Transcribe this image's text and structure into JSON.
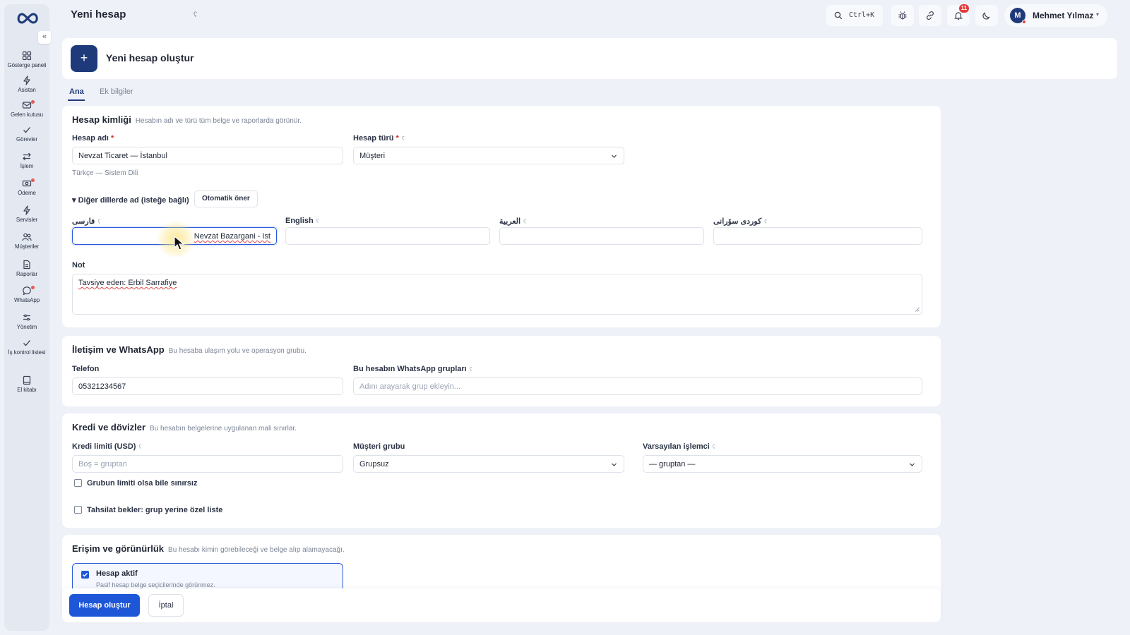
{
  "colors": {
    "accent": "#1f3a7a",
    "primary_button": "#1e56d8",
    "badge": "#e23b3b",
    "focus": "#2b5bd7"
  },
  "sidebar": {
    "collapse_icon": "«",
    "items": [
      {
        "label": "Gösterge paneli",
        "icon": "grid-icon"
      },
      {
        "label": "Asistan",
        "icon": "bolt-icon"
      },
      {
        "label": "Gelen kutusu",
        "icon": "inbox-icon"
      },
      {
        "label": "Görevler",
        "icon": "check-icon"
      },
      {
        "label": "İşlem",
        "icon": "arrows-icon"
      },
      {
        "label": "Ödeme",
        "icon": "cash-icon"
      },
      {
        "label": "Servisler",
        "icon": "bolt-icon"
      },
      {
        "label": "Müşteriler",
        "icon": "users-icon"
      },
      {
        "label": "Raporlar",
        "icon": "report-icon"
      },
      {
        "label": "WhatsApp",
        "icon": "chat-icon"
      },
      {
        "label": "Yönetim",
        "icon": "sliders-icon"
      },
      {
        "label": "İş kontrol listesi",
        "icon": "check-icon"
      },
      {
        "label": "El kitabı",
        "icon": "book-icon"
      }
    ]
  },
  "header": {
    "title": "Yeni hesap",
    "title_info": "ʕ",
    "search_shortcut": "Ctrl+K",
    "notifications_count": "11",
    "user": {
      "initial": "M",
      "name": "Mehmet Yılmaz",
      "caret": "▾"
    }
  },
  "banner": {
    "icon": "+",
    "title": "Yeni hesap oluştur"
  },
  "tabs": [
    {
      "label": "Ana"
    },
    {
      "label": "Ek bilgiler"
    }
  ],
  "identity": {
    "title": "Hesap kimliği",
    "subtitle": "Hesabın adı ve türü tüm belge ve raporlarda görünür.",
    "name_label": "Hesap adı",
    "name_value": "Nevzat Ticaret — İstanbul",
    "name_hint": "Türkçe — Sistem Dili",
    "type_label": "Hesap türü",
    "type_value": "Müşteri",
    "other_langs_label": "▾ Diğer dillerde ad (isteğe bağlı)",
    "auto_suggest": "Otomatik öner",
    "lang_fields": [
      {
        "label": "فارسی",
        "value": "Nevzat Bazargani - Ist"
      },
      {
        "label": "English",
        "value": ""
      },
      {
        "label": "العربية",
        "value": ""
      },
      {
        "label": "كوردى سۆرانى",
        "value": ""
      }
    ],
    "note_label": "Not",
    "note_value": "Tavsiye eden: Erbil Sarrafiye"
  },
  "contact": {
    "title": "İletişim ve WhatsApp",
    "subtitle": "Bu hesaba ulaşım yolu ve operasyon grubu.",
    "phone_label": "Telefon",
    "phone_value": "05321234567",
    "groups_label": "Bu hesabın WhatsApp grupları",
    "groups_placeholder": "Adını arayarak grup ekleyin..."
  },
  "credit": {
    "title": "Kredi ve dövizler",
    "subtitle": "Bu hesabın belgelerine uygulanan mali sınırlar.",
    "limit_label": "Kredi limiti (USD)",
    "limit_placeholder": "Boş = gruptan",
    "group_label": "Müşteri grubu",
    "group_value": "Grupsuz",
    "processor_label": "Varsayılan işlemci",
    "processor_value": "— gruptan —",
    "unlimited_label": "Grubun limiti olsa bile sınırsız",
    "collection_label": "Tahsilat bekler: grup yerine özel liste"
  },
  "access": {
    "title": "Erişim ve görünürlük",
    "subtitle": "Bu hesabı kimin görebileceği ve belge alıp alamayacağı.",
    "active_label": "Hesap aktif",
    "active_hint": "Pasif hesap belge seçicilerinde görünmez.",
    "active_checked": true
  },
  "footer": {
    "create_label": "Hesap oluştur",
    "cancel_label": "İptal"
  },
  "common": {
    "required_mark": "*",
    "info_mark": "ʕ"
  }
}
